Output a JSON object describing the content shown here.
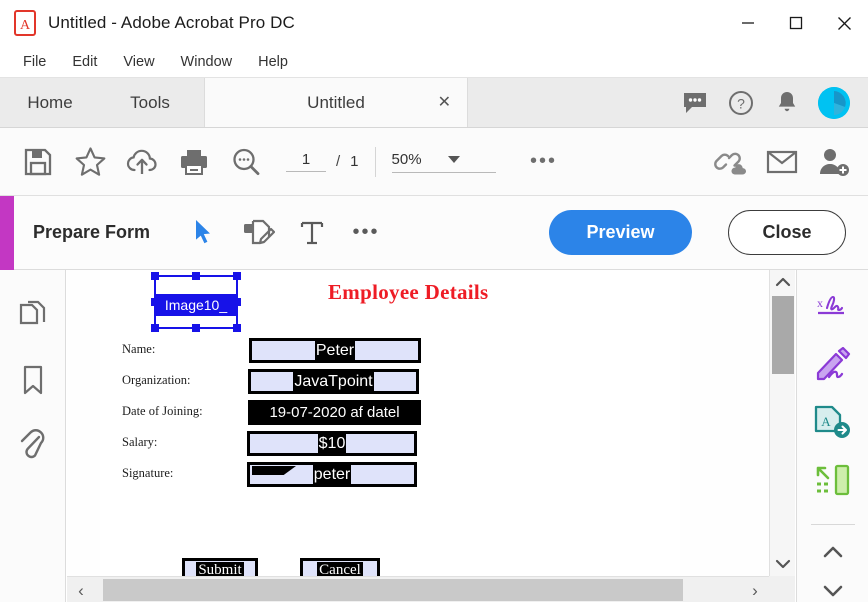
{
  "window": {
    "title": "Untitled - Adobe Acrobat Pro DC",
    "app_icon": "acrobat-pdf-icon",
    "minimize_label": "—",
    "maximize_label": "□",
    "close_label": "✕"
  },
  "menu": {
    "items": [
      {
        "label": "File"
      },
      {
        "label": "Edit"
      },
      {
        "label": "View"
      },
      {
        "label": "Window"
      },
      {
        "label": "Help"
      }
    ]
  },
  "tabs": {
    "home": "Home",
    "tools": "Tools",
    "document": "Untitled",
    "close_label": "✕",
    "right_icons": [
      {
        "name": "comment-icon"
      },
      {
        "name": "help-icon"
      },
      {
        "name": "notification-bell-icon"
      },
      {
        "name": "user-avatar"
      }
    ]
  },
  "toolbar": {
    "icons": [
      {
        "name": "save-icon"
      },
      {
        "name": "star-icon"
      },
      {
        "name": "upload-cloud-icon"
      },
      {
        "name": "print-icon"
      },
      {
        "name": "search-icon"
      }
    ],
    "page_current": "1",
    "page_separator": "/",
    "page_total": "1",
    "zoom_value": "50%",
    "more_label": "•••",
    "right_icons": [
      {
        "name": "share-link-icon"
      },
      {
        "name": "email-icon"
      },
      {
        "name": "add-person-icon"
      }
    ]
  },
  "form_toolbar": {
    "title": "Prepare Form",
    "tools": [
      {
        "name": "select-pointer-tool"
      },
      {
        "name": "add-field-tool"
      },
      {
        "name": "text-field-tool"
      },
      {
        "name": "more-tools",
        "label": "•••"
      }
    ],
    "preview_label": "Preview",
    "close_label": "Close",
    "accent_color": "#c337c3"
  },
  "left_rail": {
    "items": [
      {
        "name": "page-thumbnails-icon"
      },
      {
        "name": "bookmarks-icon"
      },
      {
        "name": "attachments-icon"
      }
    ]
  },
  "right_rail": {
    "items": [
      {
        "name": "fill-and-sign-icon"
      },
      {
        "name": "request-signature-icon"
      },
      {
        "name": "export-pdf-icon"
      },
      {
        "name": "compress-pdf-icon"
      }
    ],
    "collapse_label": "⌃"
  },
  "document": {
    "title": "Employee Details",
    "title_color": "#ee1c25",
    "selected_field": {
      "name": "Image10_",
      "selection_color": "#1712e8"
    },
    "fields": [
      {
        "label": "Name:",
        "value": "Peter",
        "type": "text"
      },
      {
        "label": "Organization:",
        "value": "JavaTpoint",
        "type": "text"
      },
      {
        "label": "Date of Joining:",
        "value": "19-07-2020 af datel",
        "type": "date"
      },
      {
        "label": "Salary:",
        "value": "$10",
        "type": "text"
      },
      {
        "label": "Signature:",
        "value": "peter",
        "type": "signature"
      }
    ],
    "buttons": [
      {
        "label": "Submit"
      },
      {
        "label": "Cancel"
      }
    ]
  },
  "scrollbars": {
    "v_up": "⌃",
    "v_down": "⌄",
    "h_left": "‹",
    "h_right": "›"
  }
}
